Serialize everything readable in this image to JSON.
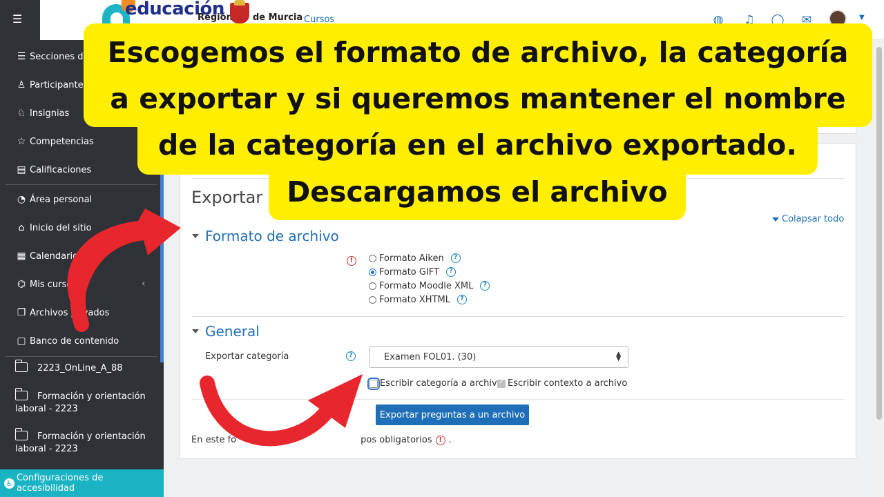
{
  "sidebar": {
    "items": [
      {
        "label": "Secciones del curso",
        "icon": "list-icon"
      },
      {
        "label": "Participantes",
        "icon": "users-icon"
      },
      {
        "label": "Insignias",
        "icon": "badge-icon"
      },
      {
        "label": "Competencias",
        "icon": "star-icon"
      },
      {
        "label": "Calificaciones",
        "icon": "table-icon"
      },
      {
        "label": "Área personal",
        "icon": "dashboard-icon"
      },
      {
        "label": "Inicio del sitio",
        "icon": "home-icon"
      },
      {
        "label": "Calendario",
        "icon": "calendar-icon"
      },
      {
        "label": "Mis cursos",
        "icon": "graduation-cap-icon"
      },
      {
        "label": "Archivos privados",
        "icon": "file-icon"
      },
      {
        "label": "Banco de contenido",
        "icon": "paste-icon"
      }
    ],
    "folders": [
      {
        "label": "2223_OnLine_A_88"
      },
      {
        "label": "Formación y orientación laboral - 2223"
      },
      {
        "label": "Formación y orientación laboral - 2223"
      }
    ],
    "accessibility_label": "Configuraciones de accesibilidad"
  },
  "navbar": {
    "logo_text": "educación",
    "region_text_1": "Región",
    "region_text_2": "de Murcia",
    "cursos_label": "Cursos"
  },
  "main": {
    "page_title": "Exportar p",
    "collapse_all": "Colapsar todo",
    "file_format_section": "Formato de archivo",
    "formats": [
      {
        "label": "Formato Aiken",
        "checked": false
      },
      {
        "label": "Formato GIFT",
        "checked": true
      },
      {
        "label": "Formato Moodle XML",
        "checked": false
      },
      {
        "label": "Formato XHTML",
        "checked": false
      }
    ],
    "general_section": "General",
    "export_category_label": "Exportar categoría",
    "export_category_value": "Examen FOL01. (30)",
    "write_category_label": "Escribir categoría a archivo",
    "write_context_label": "Escribir contexto a archivo",
    "submit_label": "Exportar preguntas a un archivo",
    "required_note_start": "En este fo",
    "required_note_end": "pos obligatorios",
    "required_note_period": "."
  },
  "callout": {
    "line1": "Escogemos el formato de archivo, la categoría",
    "line2": "a exportar y si queremos mantener el nombre",
    "line3": "de la categoría en el archivo exportado.",
    "line4": "Descargamos el archivo"
  },
  "colors": {
    "sidebar_bg": "#2f3237",
    "accent_blue": "#1f6fb8",
    "callout_yellow": "#ffee00",
    "arrow_red": "#e8262d",
    "accessibility_teal": "#19b3c4"
  }
}
